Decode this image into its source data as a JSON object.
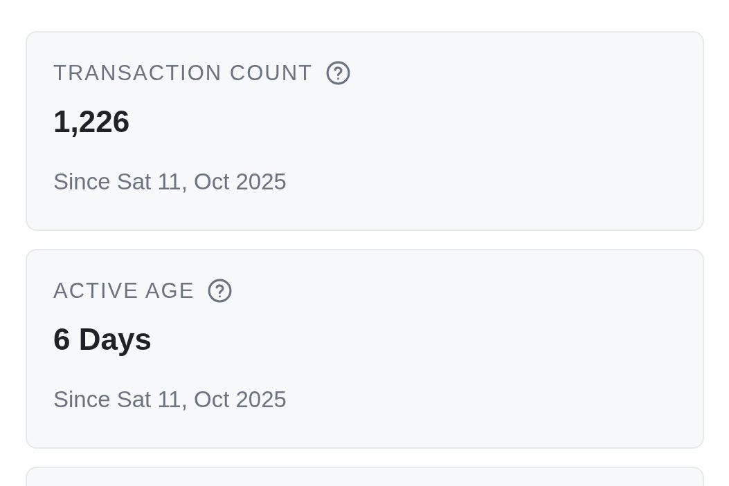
{
  "cards": [
    {
      "label": "TRANSACTION COUNT",
      "value": "1,226",
      "subtitle": "Since Sat 11, Oct 2025"
    },
    {
      "label": "ACTIVE AGE",
      "value": "6 Days",
      "subtitle": "Since Sat 11, Oct 2025"
    }
  ]
}
